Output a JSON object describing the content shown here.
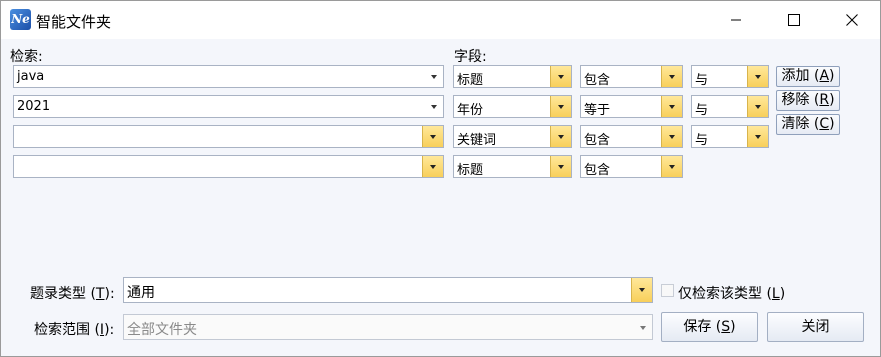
{
  "window": {
    "title": "智能文件夹",
    "app_icon_text": "Ne"
  },
  "labels": {
    "search": "检索:",
    "fields": "字段:"
  },
  "rows": [
    {
      "search_value": "java",
      "field": "标题",
      "operator": "包含",
      "conjunction": "与"
    },
    {
      "search_value": "2021",
      "field": "年份",
      "operator": "等于",
      "conjunction": "与"
    },
    {
      "search_value": "",
      "field": "关键词",
      "operator": "包含",
      "conjunction": "与"
    },
    {
      "search_value": "",
      "field": "标题",
      "operator": "包含"
    }
  ],
  "side_buttons": {
    "add": {
      "label": "添加 (",
      "key": "A",
      "end": ")"
    },
    "remove": {
      "label": "移除 (",
      "key": "R",
      "end": ")"
    },
    "clear": {
      "label": "清除 (",
      "key": "C",
      "end": ")"
    }
  },
  "record_type": {
    "label_pre": "题录类型 (",
    "label_key": "T",
    "label_post": "):",
    "value": "通用",
    "checkbox_pre": "仅检索该类型 (",
    "checkbox_key": "L",
    "checkbox_post": ")",
    "checkbox_checked": false
  },
  "scope": {
    "label_pre": "检索范围 (",
    "label_key": "I",
    "label_post": "):",
    "value": "全部文件夹"
  },
  "buttons": {
    "save": {
      "label": "保存 (",
      "key": "S",
      "end": ")"
    },
    "close": "关闭"
  },
  "colors": {
    "dropdown_button": "#f8cf5a",
    "window_background": "#f4f6fb"
  }
}
